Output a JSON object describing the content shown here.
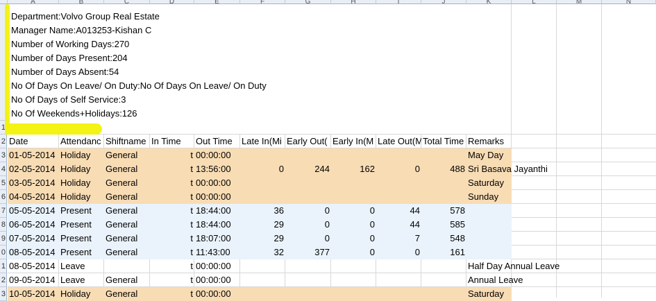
{
  "colors": {
    "holiday_fill": "#f8dcb4",
    "present_fill": "#eaf3fb",
    "highlight": "#f2f20a",
    "header_bg": "#e9eef6"
  },
  "column_letters": [
    "A",
    "B",
    "C",
    "D",
    "E",
    "F",
    "G",
    "H",
    "I",
    "J",
    "K",
    "L",
    "M",
    "N"
  ],
  "row_numbers": [
    "1",
    "2",
    "3",
    "4",
    "5",
    "6",
    "7",
    "8",
    "9",
    "0",
    "1",
    "2",
    "3"
  ],
  "info_lines": [
    "Department:Volvo Group Real Estate",
    "Manager Name:A013253-Kishan C",
    "Number of Working Days:270",
    "Number of Days Present:204",
    "Number of Days Absent:54",
    "No Of Days On Leave/ On Duty:No Of Days On Leave/ On Duty",
    "No Of Days of Self Service:3",
    "No Of Weekends+Holidays:126"
  ],
  "headers": [
    "Date",
    "Attendanc",
    "Shiftname",
    "In Time",
    "Out Time",
    "Late In(Mi",
    "Early Out(",
    "Early In(M",
    "Late Out(M",
    "Total Time",
    "Remarks"
  ],
  "rows": [
    {
      "type": "holiday",
      "cells": [
        "01-05-2014",
        "Holiday",
        "General",
        "t",
        "00:00:00",
        "",
        "",
        "",
        "",
        "",
        "May Day"
      ]
    },
    {
      "type": "holiday",
      "cells": [
        "02-05-2014",
        "Holiday",
        "General",
        "t",
        "13:56:00",
        "0",
        "244",
        "162",
        "0",
        "488",
        "Sri Basava Jayanthi"
      ]
    },
    {
      "type": "holiday",
      "cells": [
        "03-05-2014",
        "Holiday",
        "General",
        "t",
        "00:00:00",
        "",
        "",
        "",
        "",
        "",
        "Saturday"
      ]
    },
    {
      "type": "holiday",
      "cells": [
        "04-05-2014",
        "Holiday",
        "General",
        "t",
        "00:00:00",
        "",
        "",
        "",
        "",
        "",
        "Sunday"
      ]
    },
    {
      "type": "present",
      "cells": [
        "05-05-2014",
        "Present",
        "General",
        "t",
        "18:44:00",
        "36",
        "0",
        "0",
        "44",
        "578",
        ""
      ]
    },
    {
      "type": "present",
      "cells": [
        "06-05-2014",
        "Present",
        "General",
        "t",
        "18:44:00",
        "29",
        "0",
        "0",
        "44",
        "585",
        ""
      ]
    },
    {
      "type": "present",
      "cells": [
        "07-05-2014",
        "Present",
        "General",
        "t",
        "18:07:00",
        "29",
        "0",
        "0",
        "7",
        "548",
        ""
      ]
    },
    {
      "type": "present",
      "cells": [
        "08-05-2014",
        "Present",
        "General",
        "t",
        "11:43:00",
        "32",
        "377",
        "0",
        "0",
        "161",
        ""
      ]
    },
    {
      "type": "plain",
      "cells": [
        "08-05-2014",
        "Leave",
        "",
        "t",
        "00:00:00",
        "",
        "",
        "",
        "",
        "",
        "Half Day Annual Leave"
      ]
    },
    {
      "type": "plain",
      "cells": [
        "09-05-2014",
        "Leave",
        "General",
        "t",
        "00:00:00",
        "",
        "",
        "",
        "",
        "",
        "Annual Leave"
      ]
    },
    {
      "type": "holiday",
      "cells": [
        "10-05-2014",
        "Holiday",
        "General",
        "t",
        "00:00:00",
        "",
        "",
        "",
        "",
        "",
        "Saturday"
      ]
    }
  ]
}
